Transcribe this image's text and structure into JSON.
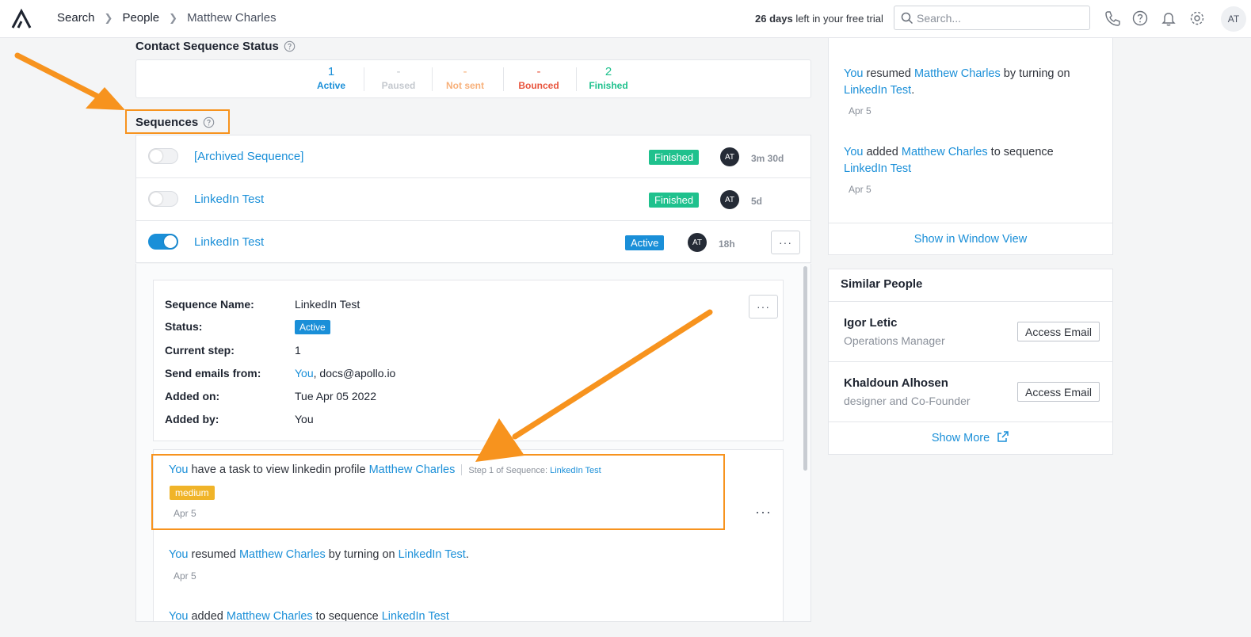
{
  "topbar": {
    "breadcrumbs": [
      "Search",
      "People",
      "Matthew Charles"
    ],
    "trial_days": "26 days",
    "trial_rest": " left in your free trial",
    "search_placeholder": "Search...",
    "avatar": "AT"
  },
  "contact_status": {
    "title": "Contact Sequence Status",
    "stats": [
      {
        "num": "1",
        "label": "Active",
        "color": "#1a8fd8"
      },
      {
        "num": "-",
        "label": "Paused",
        "color": "#c4c8ce"
      },
      {
        "num": "-",
        "label": "Not sent",
        "color": "#f7b07a"
      },
      {
        "num": "-",
        "label": "Bounced",
        "color": "#e8543d"
      },
      {
        "num": "2",
        "label": "Finished",
        "color": "#1fc18d"
      }
    ]
  },
  "sequences": {
    "title": "Sequences",
    "rows": [
      {
        "name": "[Archived Sequence]",
        "status": "Finished",
        "owner": "AT",
        "age": "3m 30d",
        "enabled": false
      },
      {
        "name": "LinkedIn Test",
        "status": "Finished",
        "owner": "AT",
        "age": "5d",
        "enabled": false
      },
      {
        "name": "LinkedIn Test",
        "status": "Active",
        "owner": "AT",
        "age": "18h",
        "enabled": true
      }
    ]
  },
  "detail": {
    "labels": {
      "name": "Sequence Name:",
      "status": "Status:",
      "step": "Current step:",
      "from": "Send emails from:",
      "added_on": "Added on:",
      "added_by": "Added by:"
    },
    "values": {
      "name": "LinkedIn Test",
      "status": "Active",
      "step": "1",
      "from_link": "You",
      "from_rest": ", docs@apollo.io",
      "added_on": "Tue Apr 05 2022",
      "added_by": "You"
    }
  },
  "activity": {
    "task": {
      "you": "You",
      "text": " have a task to view linkedin profile ",
      "person": "Matthew Charles",
      "step_label": "Step 1 of Sequence: ",
      "step_seq": "LinkedIn Test",
      "priority": "medium",
      "date": "Apr 5"
    },
    "resumed": {
      "you": "You",
      "t1": " resumed ",
      "person": "Matthew Charles",
      "t2": " by turning on ",
      "seq": "LinkedIn Test",
      "t3": ".",
      "date": "Apr 5"
    },
    "added": {
      "you": "You",
      "t1": " added ",
      "person": "Matthew Charles",
      "t2": " to sequence ",
      "seq": "LinkedIn Test"
    }
  },
  "right_panel": {
    "resumed": {
      "you": "You",
      "t1": " resumed ",
      "person": "Matthew Charles",
      "t2": " by turning on ",
      "seq": "LinkedIn Test",
      "t3": ".",
      "date": "Apr 5"
    },
    "added": {
      "you": "You",
      "t1": " added ",
      "person": "Matthew Charles",
      "t2": " to sequence ",
      "seq": "LinkedIn Test",
      "date": "Apr 5"
    },
    "show_window": "Show in Window View"
  },
  "similar_people": {
    "title": "Similar People",
    "people": [
      {
        "name": "Igor Letic",
        "title": "Operations Manager",
        "action": "Access Email"
      },
      {
        "name": "Khaldoun Alhosen",
        "title": "designer and Co-Founder",
        "action": "Access Email"
      }
    ],
    "show_more": "Show More"
  },
  "colors": {
    "accent": "#1a8fd8",
    "finished": "#1fc18d",
    "annotation": "#f7931e",
    "medium": "#f0b429"
  }
}
